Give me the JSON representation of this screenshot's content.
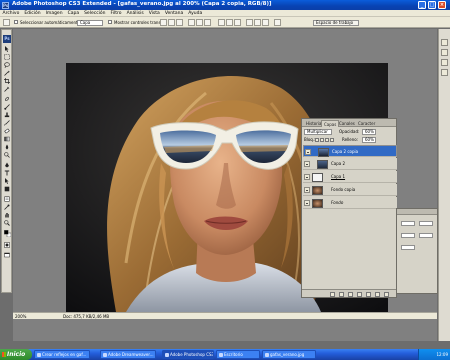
{
  "window": {
    "title": "Adobe Photoshop CS3 Extended - [gafas_verano.jpg al 200% (Capa 2 copia, RGB/8)]",
    "app_icon": "Ps"
  },
  "menubar": [
    "Archivo",
    "Edición",
    "Imagen",
    "Capa",
    "Selección",
    "Filtro",
    "Análisis",
    "Vista",
    "Ventana",
    "Ayuda"
  ],
  "options": {
    "auto_select_label": "Seleccionar automáticamente:",
    "auto_select_value": "Capa",
    "transform_label": "Mostrar controles transf.",
    "workspace_label": "Espacio de trabajo"
  },
  "status": {
    "zoom": "200%",
    "doc_info": "Doc: 475,7 KB/2,46 MB"
  },
  "layers_panel": {
    "tabs": [
      "Historia",
      "Capas",
      "Canales",
      "Caracter"
    ],
    "active_tab": "Capas",
    "blend_mode": "Multiplicar",
    "opacity_label": "Opacidad:",
    "opacity_value": "60%",
    "lock_label": "Bloq.:",
    "fill_label": "Relleno:",
    "fill_value": "60%",
    "layers": [
      {
        "name": "Capa 2 copia",
        "selected": true
      },
      {
        "name": "Capa 2",
        "selected": false
      },
      {
        "name": "Capa 1",
        "selected": false
      },
      {
        "name": "Fondo copia",
        "selected": false
      },
      {
        "name": "Fondo",
        "selected": false
      }
    ]
  },
  "taskbar": {
    "start_label": "Inicio",
    "tasks": [
      "Crear reflejos en gaf...",
      "Adobe Dreamweaver...",
      "Adobe Photoshop CS3...",
      "Escritorio",
      "gafas_verano.jpg"
    ],
    "clock": "12:09"
  },
  "colors": {
    "titlebar": "#0a50c8",
    "selection": "#316ac5",
    "start_button": "#3c9a38"
  }
}
